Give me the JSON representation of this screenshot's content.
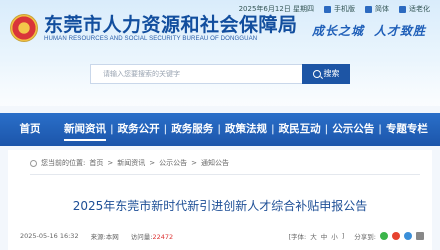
{
  "header": {
    "org_name": "东莞市人力资源和社会保障局",
    "org_name_en": "HUMAN RESOURCES AND SOCIAL SECURITY BUREAU OF DONGGUAN",
    "date": "2025年6月12日 星期四",
    "links": [
      "手机版",
      "简体",
      "适老化"
    ],
    "slogan": [
      "成长之城",
      "人才致胜"
    ]
  },
  "search": {
    "placeholder": "请输入您要搜索的关键字",
    "button_label": "搜索"
  },
  "nav": {
    "items": [
      "首页",
      "新闻资讯",
      "政务公开",
      "政务服务",
      "政策法规",
      "政民互动",
      "公示公告",
      "专题专栏"
    ],
    "active": "新闻资讯"
  },
  "breadcrumb": {
    "prefix": "您当前的位置:",
    "items": [
      "首页",
      "新闻资讯",
      "公示公告",
      "通知公告"
    ],
    "separator": ">"
  },
  "article": {
    "title": "2025年东莞市新时代新引进创新人才综合补贴申报公告",
    "date": "2025-05-16 16:32",
    "source_label": "来源:",
    "source": "本网",
    "hits_label": "访问量:",
    "hits": "22472",
    "fontsize_label": "[字体:",
    "fontsize_options": [
      "大",
      "中",
      "小"
    ],
    "fontsize_end": "]",
    "share_label": "分享到:"
  },
  "colors": {
    "brand": "#1d55a5",
    "title": "#1e4f96",
    "nav": "#2264bd"
  }
}
